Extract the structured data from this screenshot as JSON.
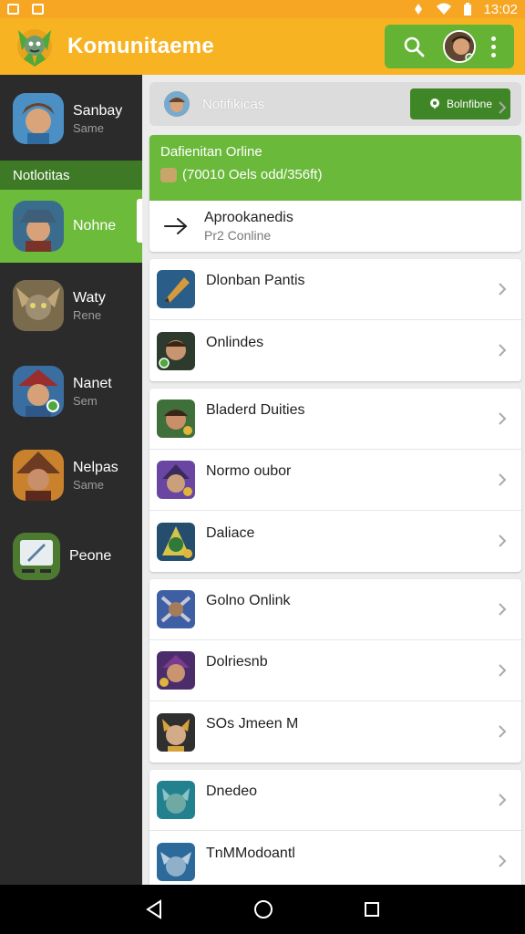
{
  "status_bar": {
    "time": "13:02"
  },
  "app": {
    "title": "Komunitaeme"
  },
  "sidebar": {
    "items": [
      {
        "name": "Sanbay",
        "sub": "Same",
        "color": "#4a90c4"
      },
      {
        "name": "Nohne",
        "sub": "",
        "color": "#3a6d8d"
      },
      {
        "name": "Waty",
        "sub": "Rene",
        "color": "#7b6b4d"
      },
      {
        "name": "Nanet",
        "sub": "Sem",
        "color": "#3b6ea0"
      },
      {
        "name": "Nelpas",
        "sub": "Same",
        "color": "#c9822b"
      },
      {
        "name": "Peone",
        "sub": "",
        "color": "#4d7a31"
      }
    ],
    "section_label": "Notlotitas"
  },
  "notifications": {
    "title": "Notifikicas",
    "button_label": "Bolnfibne"
  },
  "featured": {
    "title": "Dafienitan Orline",
    "subtitle": "(70010 Oels odd/356ft)",
    "item_name": "Aprookanedis",
    "item_sub": "Pr2 Conline"
  },
  "list": [
    [
      {
        "label": "Dlonban Pantis",
        "color": "#2a5d88"
      },
      {
        "label": "Onlindes",
        "color": "#2d3a2e"
      }
    ],
    [
      {
        "label": "Bladerd Duities",
        "color": "#3f6f3a"
      },
      {
        "label": "Normo oubor",
        "color": "#6a46a3"
      },
      {
        "label": "Daliace",
        "color": "#254d6e"
      }
    ],
    [
      {
        "label": "Golno Onlink",
        "color": "#3f5fa4"
      },
      {
        "label": "Dolriesnb",
        "color": "#4b2d6b"
      },
      {
        "label": "SOs Jmeen M",
        "color": "#2f2f2f"
      }
    ],
    [
      {
        "label": "Dnedeo",
        "color": "#23818f"
      },
      {
        "label": "TnMModoantl",
        "color": "#2c6a9c"
      }
    ]
  ],
  "colors": {
    "accent_orange": "#f8b322",
    "accent_green": "#6ab93b",
    "sidebar_bg": "#2b2b2b"
  }
}
